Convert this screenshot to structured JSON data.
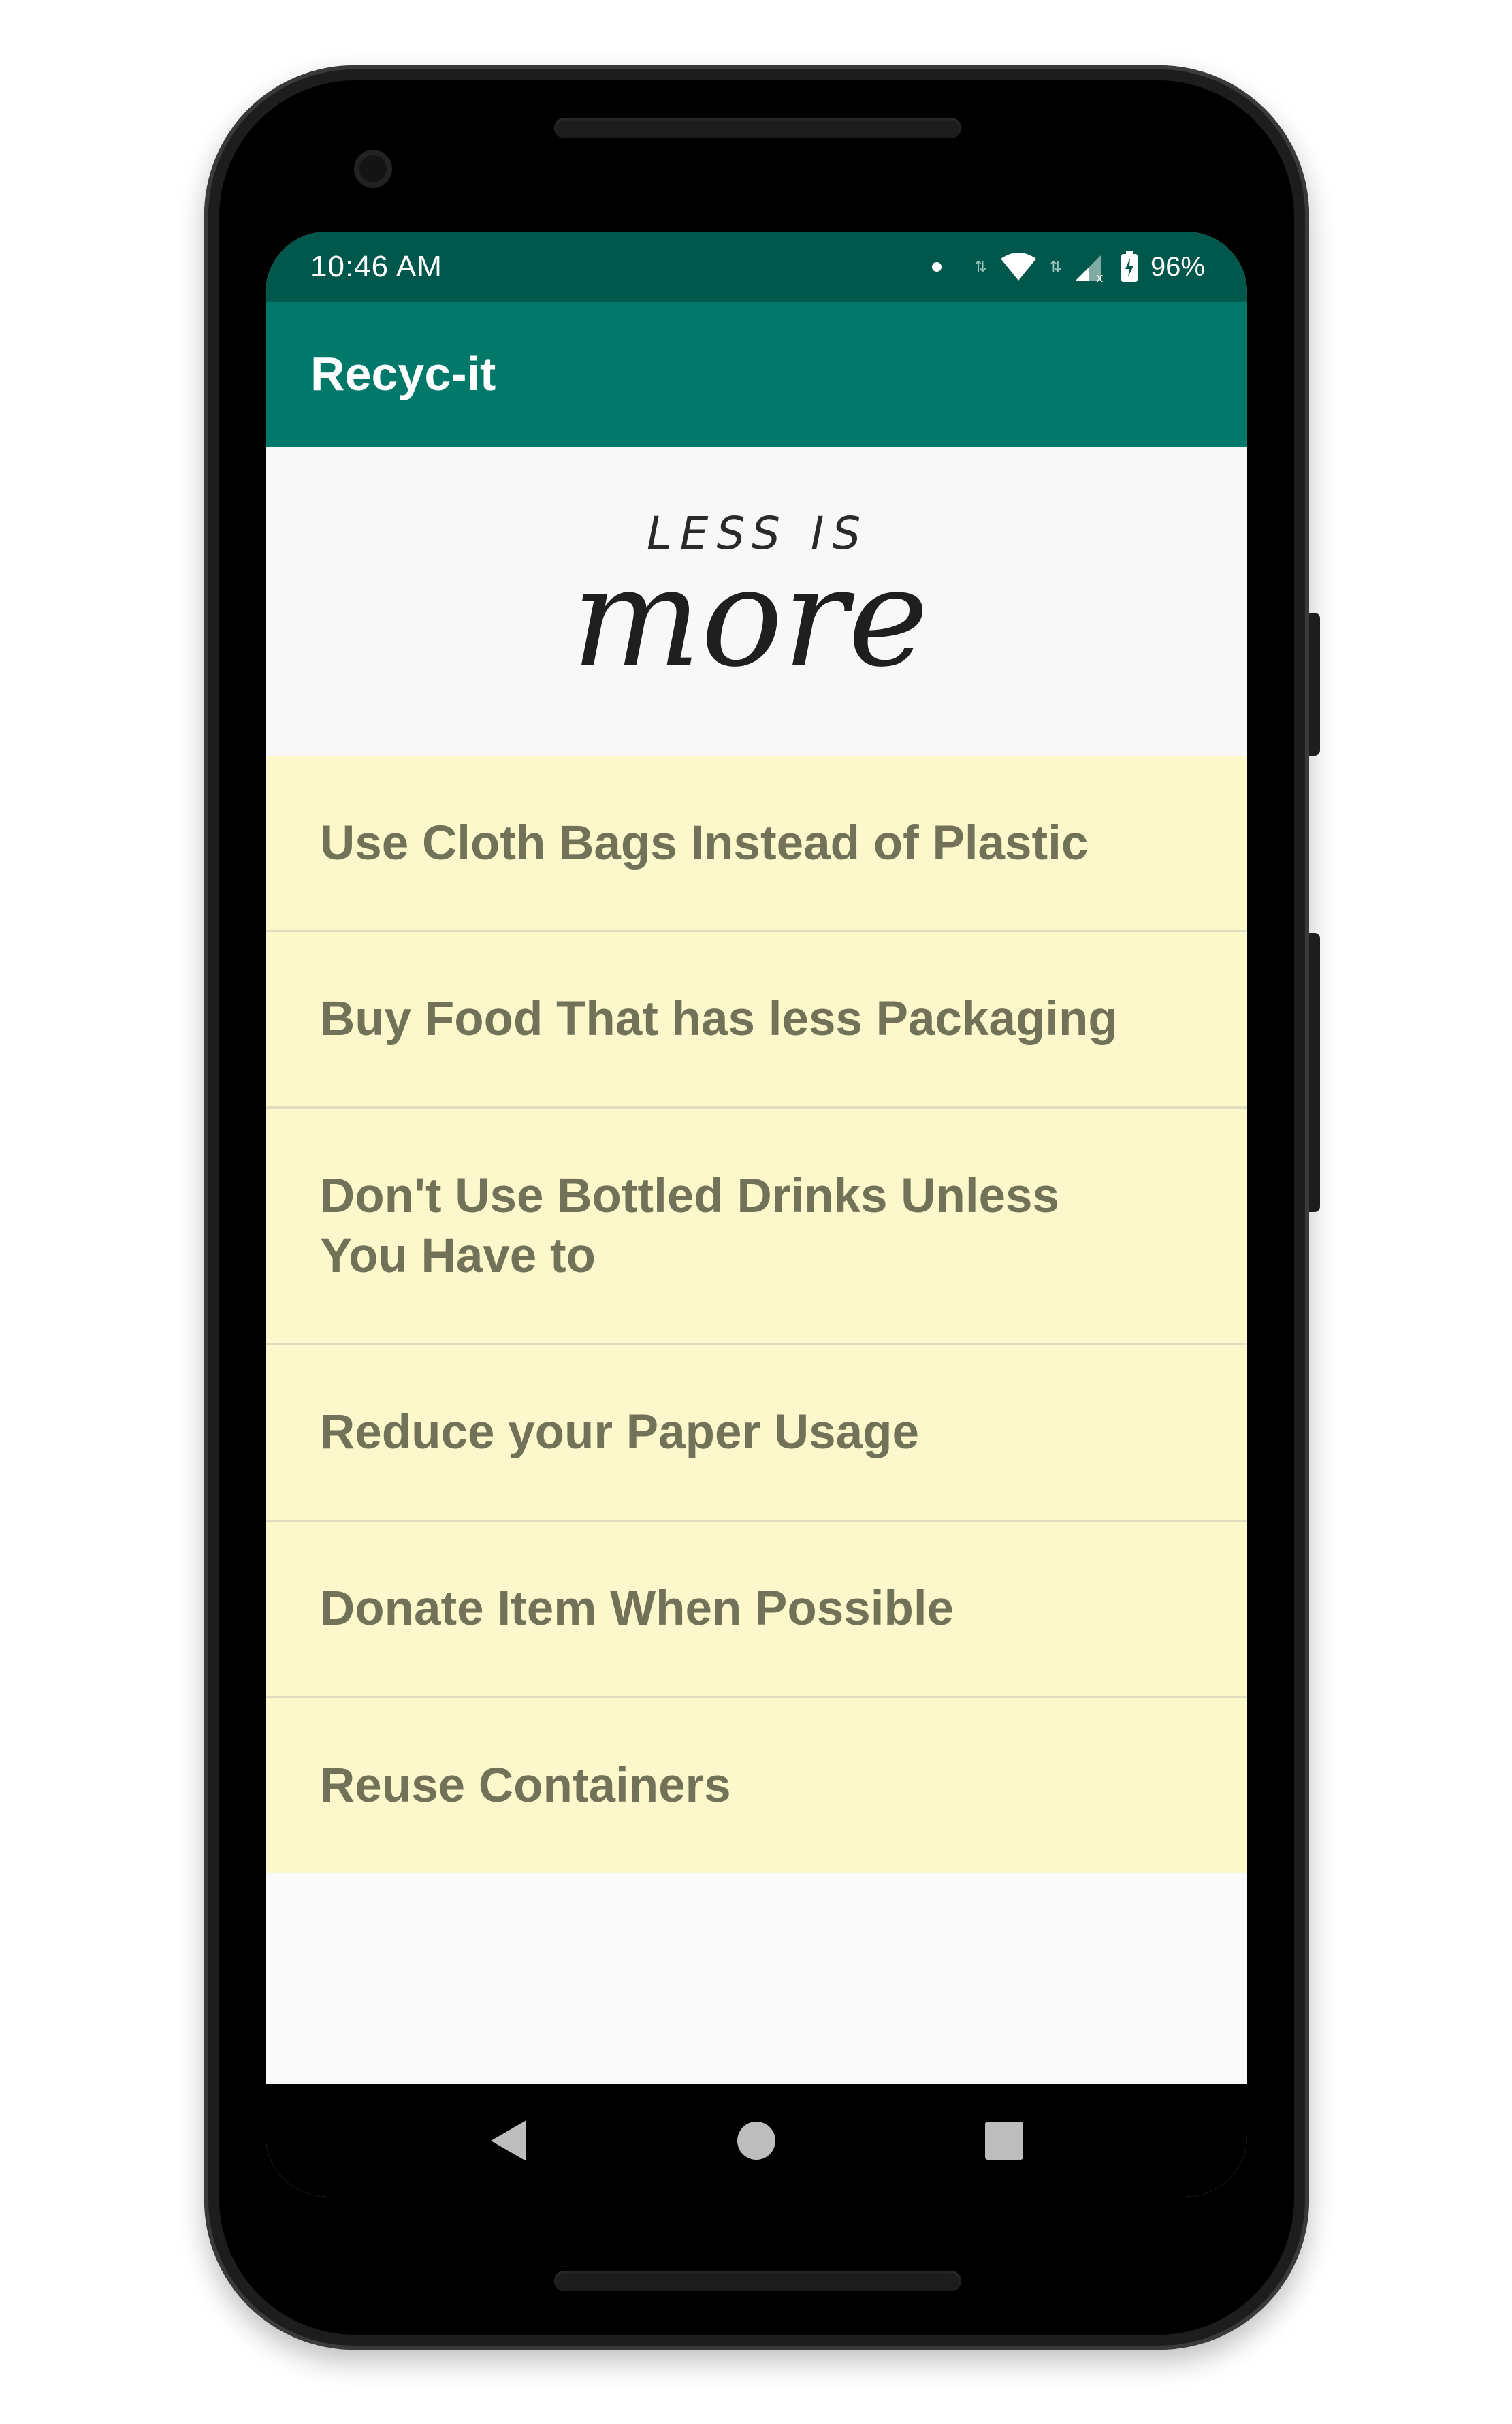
{
  "status_bar": {
    "time": "10:46 AM",
    "battery": "96%"
  },
  "app_bar": {
    "title": "Recyc-it"
  },
  "banner": {
    "line1": "LESS IS",
    "line2": "more"
  },
  "tips": [
    "Use Cloth Bags Instead of Plastic",
    "Buy Food That has less Packaging",
    "Don't Use Bottled Drinks Unless You Have to",
    "Reduce your Paper Usage",
    "Donate Item When Possible",
    "Reuse Containers"
  ],
  "colors": {
    "status_bar": "#00574b",
    "app_bar": "#00796b",
    "list_item_bg": "#fdf8cc",
    "list_item_text": "#727259"
  },
  "nav": {
    "back": "back-icon",
    "home": "home-icon",
    "recents": "recents-icon"
  }
}
